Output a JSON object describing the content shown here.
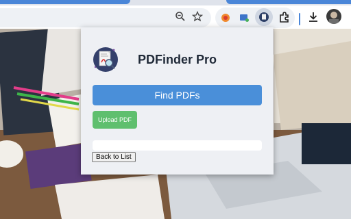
{
  "browser": {
    "toolbar_icons": [
      "zoom-out-icon",
      "bookmark-star-icon",
      "extension-orange-icon",
      "extension-screen-icon",
      "pdfinder-extension-icon",
      "puzzle-icon",
      "download-icon",
      "avatar"
    ]
  },
  "popup": {
    "title": "PDFinder Pro",
    "find_label": "Find PDFs",
    "upload_label": "Upload PDF",
    "back_label": "Back to List",
    "progress_value": 0
  },
  "colors": {
    "primary": "#4a8fd9",
    "success": "#5fbf6e",
    "popup_bg": "#eef0f4",
    "title": "#1f2937"
  }
}
